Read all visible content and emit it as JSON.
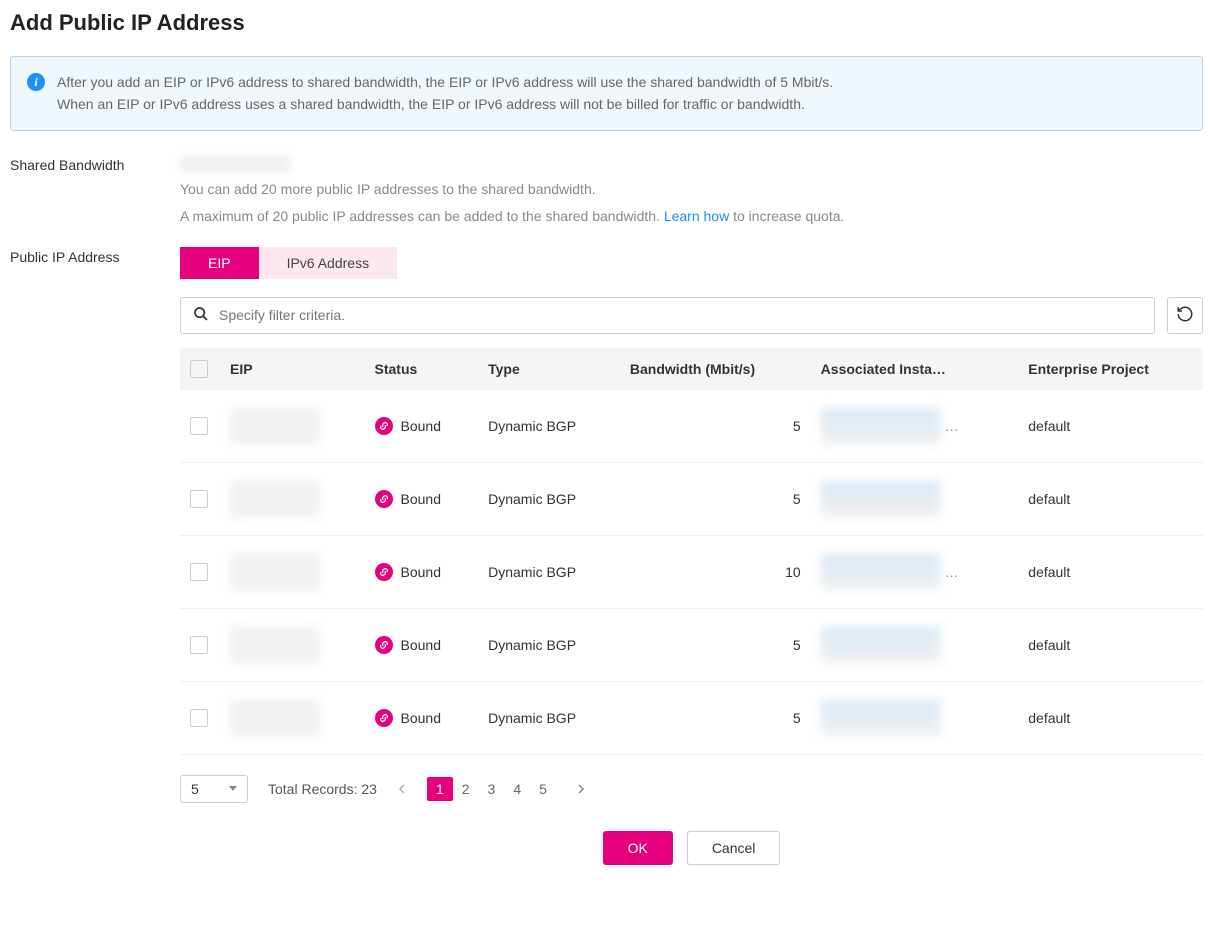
{
  "title": "Add Public IP Address",
  "info": {
    "line1": "After you add an EIP or IPv6 address to shared bandwidth, the EIP or IPv6 address will use the shared bandwidth of 5 Mbit/s.",
    "line2": "When an EIP or IPv6 address uses a shared bandwidth, the EIP or IPv6 address will not be billed for traffic or bandwidth."
  },
  "form": {
    "shared_bandwidth_label": "Shared Bandwidth",
    "shared_bandwidth_value": "redacted",
    "hint1": "You can add 20 more public IP addresses to the shared bandwidth.",
    "hint2a": "A maximum of 20 public IP addresses can be added to the shared bandwidth. ",
    "learn_how": "Learn how",
    "hint2b": " to increase quota.",
    "public_ip_label": "Public IP Address"
  },
  "tabs": {
    "eip": "EIP",
    "ipv6": "IPv6 Address"
  },
  "search": {
    "placeholder": "Specify filter criteria."
  },
  "table": {
    "headers": {
      "eip": "EIP",
      "status": "Status",
      "type": "Type",
      "bandwidth": "Bandwidth (Mbit/s)",
      "instance": "Associated Insta…",
      "project": "Enterprise Project"
    },
    "rows": [
      {
        "status": "Bound",
        "type": "Dynamic BGP",
        "bandwidth": "5",
        "project": "default",
        "ellipsis": "…"
      },
      {
        "status": "Bound",
        "type": "Dynamic BGP",
        "bandwidth": "5",
        "project": "default",
        "ellipsis": ""
      },
      {
        "status": "Bound",
        "type": "Dynamic BGP",
        "bandwidth": "10",
        "project": "default",
        "ellipsis": "…"
      },
      {
        "status": "Bound",
        "type": "Dynamic BGP",
        "bandwidth": "5",
        "project": "default",
        "ellipsis": ""
      },
      {
        "status": "Bound",
        "type": "Dynamic BGP",
        "bandwidth": "5",
        "project": "default",
        "ellipsis": ""
      }
    ]
  },
  "pager": {
    "page_size": "5",
    "total_label": "Total Records: 23",
    "pages": [
      "1",
      "2",
      "3",
      "4",
      "5"
    ]
  },
  "footer": {
    "ok": "OK",
    "cancel": "Cancel"
  }
}
